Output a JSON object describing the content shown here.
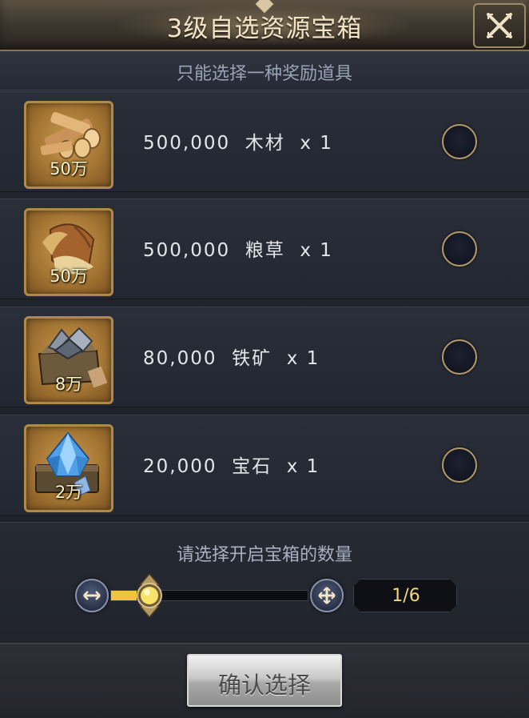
{
  "dialog": {
    "title": "3级自选资源宝箱",
    "subtitle": "只能选择一种奖励道具"
  },
  "items": [
    {
      "icon": "wood-icon",
      "badge": "50万",
      "amount": "500,000",
      "name": "木材",
      "multiplier": "x 1"
    },
    {
      "icon": "grain-icon",
      "badge": "50万",
      "amount": "500,000",
      "name": "粮草",
      "multiplier": "x 1"
    },
    {
      "icon": "iron-ore-icon",
      "badge": "8万",
      "amount": "80,000",
      "name": "铁矿",
      "multiplier": "x 1"
    },
    {
      "icon": "gem-icon",
      "badge": "2万",
      "amount": "20,000",
      "name": "宝石",
      "multiplier": "x 1"
    }
  ],
  "quantity": {
    "label": "请选择开启宝箱的数量",
    "count_text": "1/6",
    "current": 1,
    "max": 6
  },
  "footer": {
    "confirm_label": "确认选择"
  },
  "colors": {
    "accent_gold": "#b08a4a",
    "slider_fill": "#f0c340",
    "count_text": "#f1d77c"
  }
}
